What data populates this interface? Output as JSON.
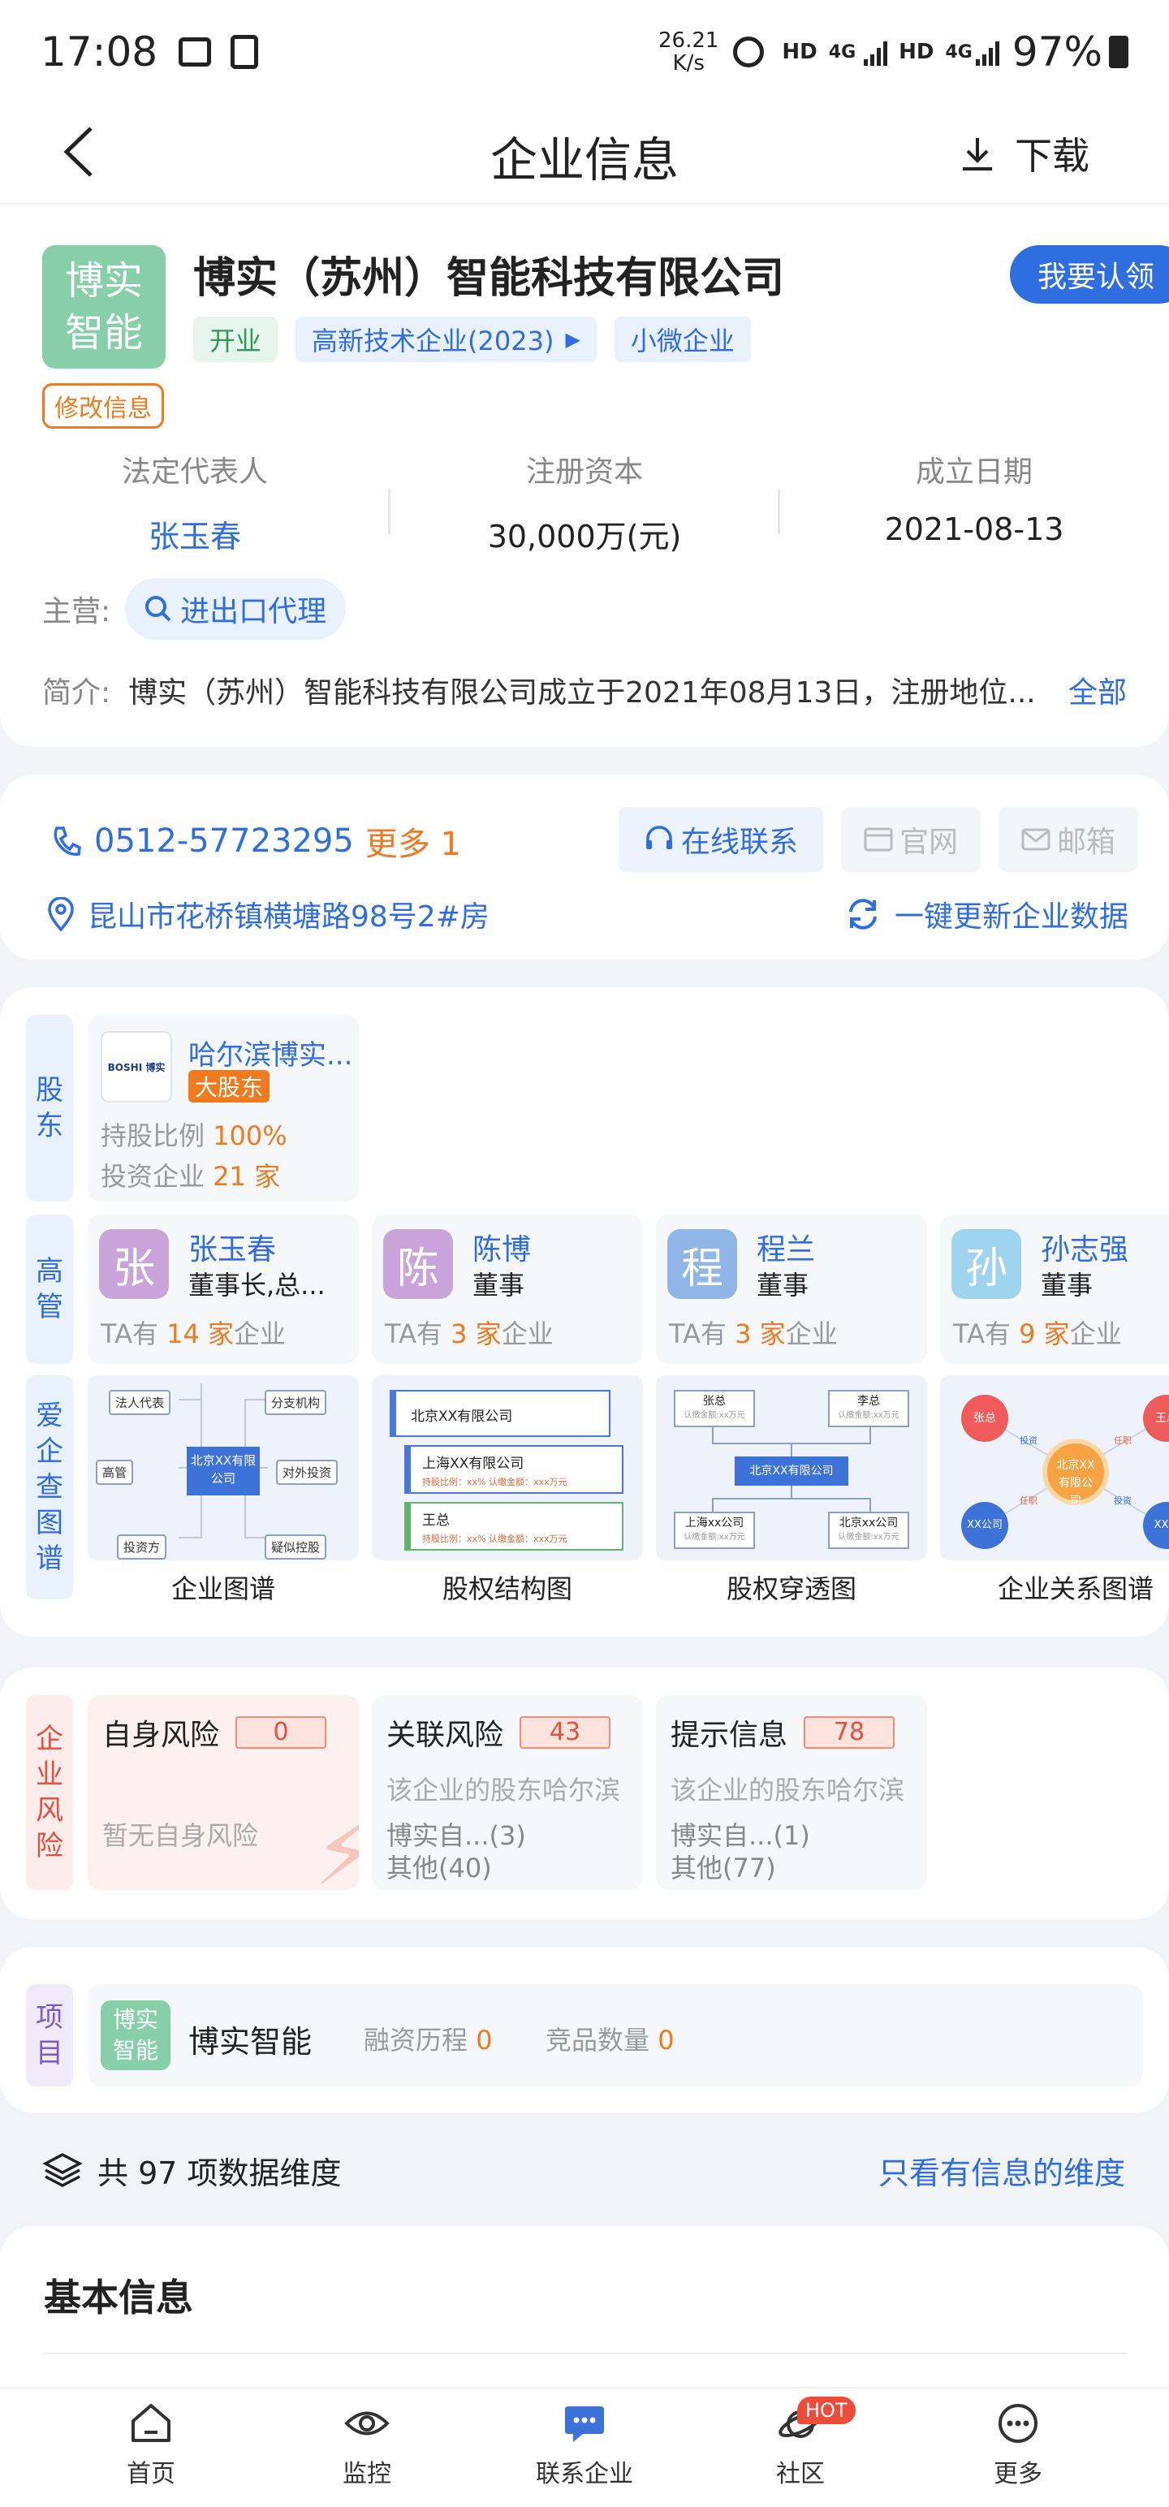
{
  "status_bar": {
    "time": "17:08",
    "net_speed_top": "26.21",
    "net_speed_bottom": "K/s",
    "hd1": "HD",
    "g1": "4G",
    "hd2": "HD",
    "g2": "4G",
    "battery": "97%"
  },
  "header": {
    "title": "企业信息",
    "download_label": "下载"
  },
  "company": {
    "logo_text": "博实智能",
    "name": "博实（苏州）智能科技有限公司",
    "claim_button": "我要认领",
    "tags": [
      "开业",
      "高新技术企业(2023)",
      "小微企业"
    ],
    "edit_label": "修改信息",
    "stats": [
      {
        "label": "法定代表人",
        "value": "张玉春"
      },
      {
        "label": "注册资本",
        "value": "30,000万(元)"
      },
      {
        "label": "成立日期",
        "value": "2021-08-13"
      }
    ],
    "business_label": "主营:",
    "business_chip": "进出口代理",
    "intro_label": "简介:",
    "intro_text": "博实（苏州）智能科技有限公司成立于2021年08月13日，注册地位...",
    "intro_more": "全部"
  },
  "contact": {
    "phone": "0512-57723295",
    "more": "更多 1",
    "online": "在线联系",
    "website": "官网",
    "email": "邮箱",
    "address": "昆山市花桥镇横塘路98号2#房",
    "refresh": "一键更新企业数据"
  },
  "shareholders": {
    "section_label": [
      "股",
      "东"
    ],
    "name": "哈尔滨博实...",
    "badge": "大股东",
    "ratio_label": "持股比例",
    "ratio_value": "100%",
    "invest_label": "投资企业",
    "invest_count": "21",
    "invest_unit": "家",
    "logo_text": "BOSHI 博实"
  },
  "executives": {
    "section_label": [
      "高",
      "管"
    ],
    "items": [
      {
        "avatar": "张",
        "name": "张玉春",
        "role": "董事长,总...",
        "count": "14",
        "color": "#c9a4da"
      },
      {
        "avatar": "陈",
        "name": "陈博",
        "role": "董事",
        "count": "3",
        "color": "#c9a4da"
      },
      {
        "avatar": "程",
        "name": "程兰",
        "role": "董事",
        "count": "3",
        "color": "#8fb6e6"
      },
      {
        "avatar": "孙",
        "name": "孙志强",
        "role": "董事",
        "count": "9",
        "color": "#9fd4ee"
      }
    ],
    "ta_prefix": "TA有",
    "ta_unit": "家",
    "ta_suffix": "企业"
  },
  "graphs": {
    "section_label": [
      "爱",
      "企",
      "查",
      "图",
      "谱"
    ],
    "items": [
      "企业图谱",
      "股权结构图",
      "股权穿透图",
      "企业关系图谱"
    ],
    "g1": {
      "center": "北京XX有限公司",
      "legal": "法人代表",
      "branch": "分支机构",
      "exec": "高管",
      "invest_out": "对外投资",
      "investor": "投资方",
      "suspect": "疑似控股"
    },
    "g2": {
      "a": "北京XX有限公司",
      "b": "上海XX有限公司",
      "b_sub": "持股比例：xx%  认缴金额：xxx万元",
      "c": "王总",
      "c_sub": "持股比例：xx%  认缴金额：xxx万元"
    },
    "g3": {
      "a": "张总",
      "a_sub": "认缴金额:xx万元",
      "b": "李总",
      "b_sub": "认缴金额:xx万元",
      "center": "北京XX有限公司",
      "c": "上海xx公司",
      "c_sub": "认缴金额:xx万元",
      "d": "北京xx公司",
      "d_sub": "认缴金额:xx万元"
    },
    "g4": {
      "a": "张总",
      "b": "王总",
      "center": "北京XX有限公司",
      "c": "XX公司",
      "d": "XX公",
      "e1": "投资",
      "e2": "任职",
      "e3": "任职",
      "e4": "投资"
    }
  },
  "risk": {
    "section_label": [
      "企",
      "业",
      "风",
      "险"
    ],
    "self": {
      "title": "自身风险",
      "count": "0",
      "desc": "暂无自身风险"
    },
    "related": {
      "title": "关联风险",
      "count": "43",
      "line1": "该企业的股东哈尔滨",
      "line2": "博实自...(3)",
      "line3": "其他(40)"
    },
    "notice": {
      "title": "提示信息",
      "count": "78",
      "line1": "该企业的股东哈尔滨",
      "line2": "博实自...(1)",
      "line3": "其他(77)"
    }
  },
  "project": {
    "section_label": [
      "项",
      "目"
    ],
    "logo": "博实智能",
    "name": "博实智能",
    "funding_label": "融资历程",
    "funding_count": "0",
    "compete_label": "竞品数量",
    "compete_count": "0"
  },
  "dimensions": {
    "text": "共 97 项数据维度",
    "filter": "只看有信息的维度"
  },
  "basic": {
    "title": "基本信息"
  },
  "bottom_nav": [
    {
      "label": "首页"
    },
    {
      "label": "监控"
    },
    {
      "label": "联系企业"
    },
    {
      "label": "社区",
      "badge": "HOT"
    },
    {
      "label": "更多"
    }
  ],
  "colors": {
    "accent": "#2f6ee0",
    "orange": "#ef7a1f",
    "green_logo": "#86cfa8",
    "claim": "#2f6ee0"
  }
}
